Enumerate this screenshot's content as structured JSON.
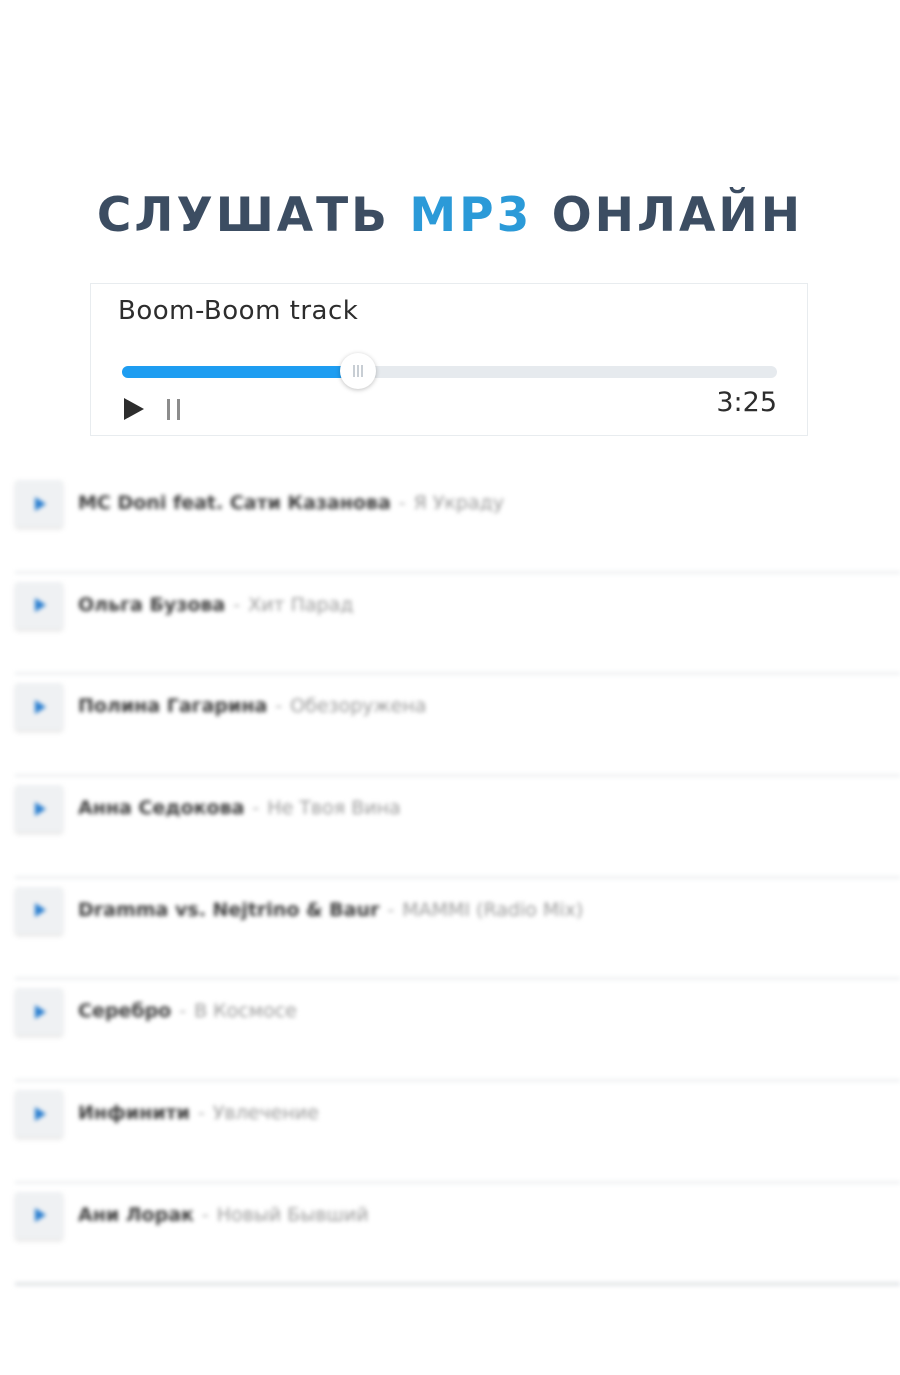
{
  "header": {
    "title_part1": "СЛУШАТЬ",
    "title_accent": "MP3",
    "title_part2": "ОНЛАЙН",
    "accent_color": "#2b9ad8",
    "title_color": "#3c4d62"
  },
  "player": {
    "track_title": "Boom-Boom track",
    "time": "3:25",
    "progress_percent": 36,
    "play_icon": "play-icon",
    "pause_icon": "pause-icon",
    "accent_color": "#1e9df1"
  },
  "playlist": {
    "separator": "-",
    "items": [
      {
        "artist": "MC Doni feat. Сати Казанова",
        "song": "Я Украду"
      },
      {
        "artist": "Ольга Бузова",
        "song": "Хит Парад"
      },
      {
        "artist": "Полина Гагарина",
        "song": "Обезоружена"
      },
      {
        "artist": "Анна Седокова",
        "song": "Не Твоя Вина"
      },
      {
        "artist": "Dramma vs. Nejtrino & Baur",
        "song": "MAMMI (Radio Mix)"
      },
      {
        "artist": "Серебро",
        "song": "В Космосе"
      },
      {
        "artist": "Инфинити",
        "song": "Увлечение"
      },
      {
        "artist": "Ани Лорак",
        "song": "Новый Бывший"
      }
    ]
  }
}
